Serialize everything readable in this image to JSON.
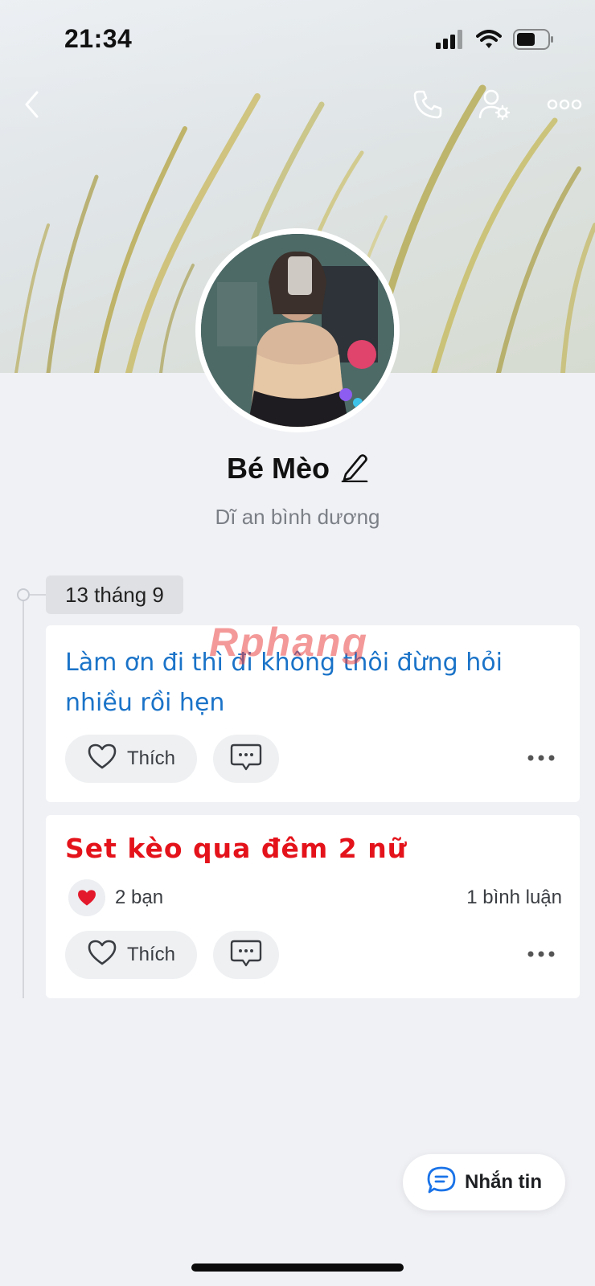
{
  "status_bar": {
    "time": "21:34"
  },
  "profile": {
    "name": "Bé Mèo",
    "location": "Dĩ an bình dương"
  },
  "timeline": {
    "date_label": "13 tháng 9"
  },
  "posts": [
    {
      "text": "Làm ơn đi thì đi không thôi đừng hỏi nhiều rồi hẹn",
      "like_label": "Thích"
    },
    {
      "text": "Set kèo qua đêm 2 nữ",
      "like_label": "Thích",
      "reactions_label": "2 bạn",
      "comments_label": "1 bình luận"
    }
  ],
  "message_button": {
    "label": "Nhắn tin"
  },
  "watermark": "Rphang",
  "colors": {
    "accent_blue": "#1a73c8",
    "post_red": "#e4131b",
    "background": "#f0f1f5"
  },
  "icons": {
    "nav": [
      "back-arrow-icon",
      "phone-icon",
      "user-settings-icon",
      "more-icon"
    ],
    "status": [
      "cellular-signal-icon",
      "wifi-icon",
      "battery-icon"
    ]
  }
}
